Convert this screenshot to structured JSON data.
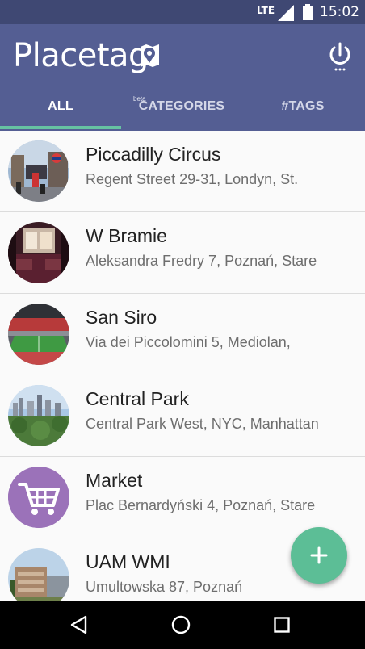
{
  "status_bar": {
    "network": "LTE",
    "time": "15:02"
  },
  "app_bar": {
    "logo_text": "Placetag",
    "logo_badge": "beta",
    "colors": {
      "status": "#3f4873",
      "app_bar": "#545e93",
      "accent": "#66c3a2"
    }
  },
  "tabs": [
    {
      "label": "ALL",
      "selected": true
    },
    {
      "label": "CATEGORIES",
      "selected": false
    },
    {
      "label": "#TAGS",
      "selected": false
    }
  ],
  "places": [
    {
      "title": "Piccadilly Circus",
      "address": "Regent Street 29-31, Londyn, St.",
      "avatar": "london-street-photo"
    },
    {
      "title": "W Bramie",
      "address": "Aleksandra Fredry 7, Poznań, Stare",
      "avatar": "pub-interior-photo"
    },
    {
      "title": "San Siro",
      "address": "Via dei Piccolomini 5, Mediolan,",
      "avatar": "stadium-photo"
    },
    {
      "title": "Central Park",
      "address": "Central Park West, NYC, Manhattan",
      "avatar": "park-skyline-photo"
    },
    {
      "title": "Market",
      "address": "Plac Bernardyński 4, Poznań, Stare",
      "avatar": "shopping-cart-icon"
    },
    {
      "title": "UAM WMI",
      "address": "Umultowska 87, Poznań",
      "avatar": "university-building-photo"
    }
  ],
  "fab": {
    "icon": "plus-icon",
    "color": "#5cbe96"
  },
  "nav_bar": {
    "icons": [
      "back-icon",
      "home-icon",
      "recents-icon"
    ]
  }
}
